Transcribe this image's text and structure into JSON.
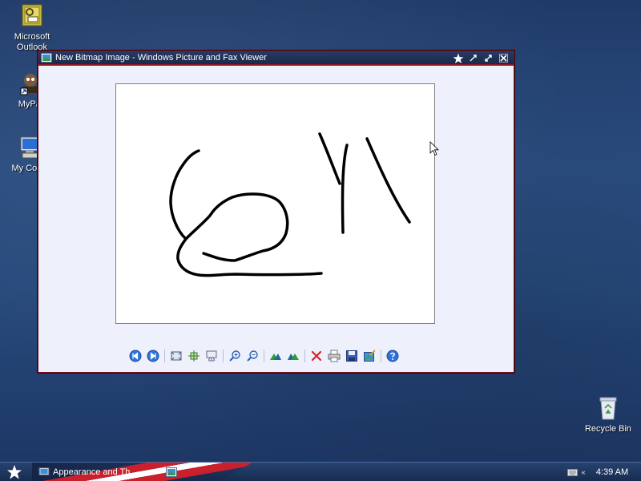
{
  "desktop": {
    "icons": [
      {
        "label_line1": "Microsoft",
        "label_line2": "Outlook"
      },
      {
        "label": "MyPal"
      },
      {
        "label": "My Comp"
      },
      {
        "label": "Recycle Bin"
      }
    ]
  },
  "window": {
    "title": "New Bitmap Image - Windows Picture and Fax Viewer"
  },
  "toolbar": {
    "buttons": [
      "previous-image",
      "next-image",
      "best-fit",
      "actual-size",
      "slide-show",
      "zoom-in",
      "zoom-out",
      "rotate-clockwise",
      "rotate-counterclockwise",
      "delete",
      "print",
      "copy-to",
      "edit",
      "help"
    ]
  },
  "taskbar": {
    "task1_label": "Appearance and Th...",
    "clock": "4:39 AM"
  },
  "colors": {
    "desktop": "#274a7c",
    "titlebar": "#1a2a4c",
    "window_border": "#8d1a25",
    "client_bg": "#eef1fb"
  }
}
